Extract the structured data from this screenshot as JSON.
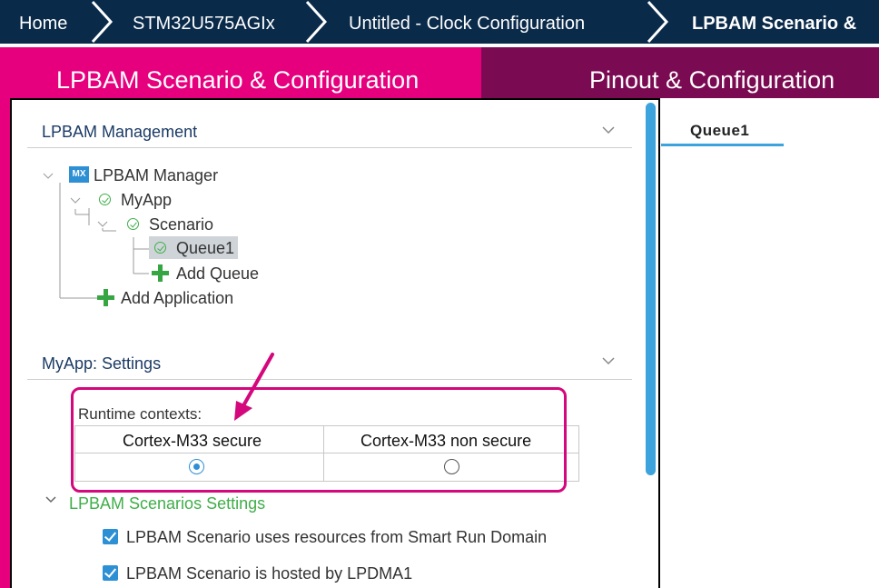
{
  "breadcrumb": {
    "items": [
      "Home",
      "STM32U575AGIx",
      "Untitled - Clock Configuration",
      "LPBAM Scenario &"
    ],
    "bg_color": "#0a2a4a"
  },
  "tabs": [
    {
      "label": "LPBAM Scenario & Configuration",
      "active": true,
      "color": "#e6007e"
    },
    {
      "label": "Pinout & Configuration",
      "active": false,
      "color": "#7a0a52"
    }
  ],
  "management": {
    "title": "LPBAM Management",
    "tree": {
      "mx_badge": "MX",
      "manager": "LPBAM Manager",
      "app": "MyApp",
      "scenario": "Scenario",
      "queue": "Queue1",
      "add_queue": "Add Queue",
      "add_application": "Add Application"
    }
  },
  "settings": {
    "title": "MyApp: Settings",
    "runtime_label": "Runtime contexts:",
    "contexts": [
      {
        "label": "Cortex-M33 secure",
        "selected": true
      },
      {
        "label": "Cortex-M33 non secure",
        "selected": false
      }
    ],
    "scenarios_title": "LPBAM Scenarios Settings",
    "checkboxes": [
      {
        "label": "LPBAM Scenario uses resources from Smart Run Domain",
        "checked": true
      },
      {
        "label": "LPBAM Scenario is hosted by LPDMA1",
        "checked": true
      }
    ]
  },
  "right_panel": {
    "tab": "Queue1"
  },
  "icons": {
    "chevron": "chevron-down-icon",
    "status": "check-circle-icon",
    "add": "plus-icon",
    "annotation": "arrow-icon"
  }
}
